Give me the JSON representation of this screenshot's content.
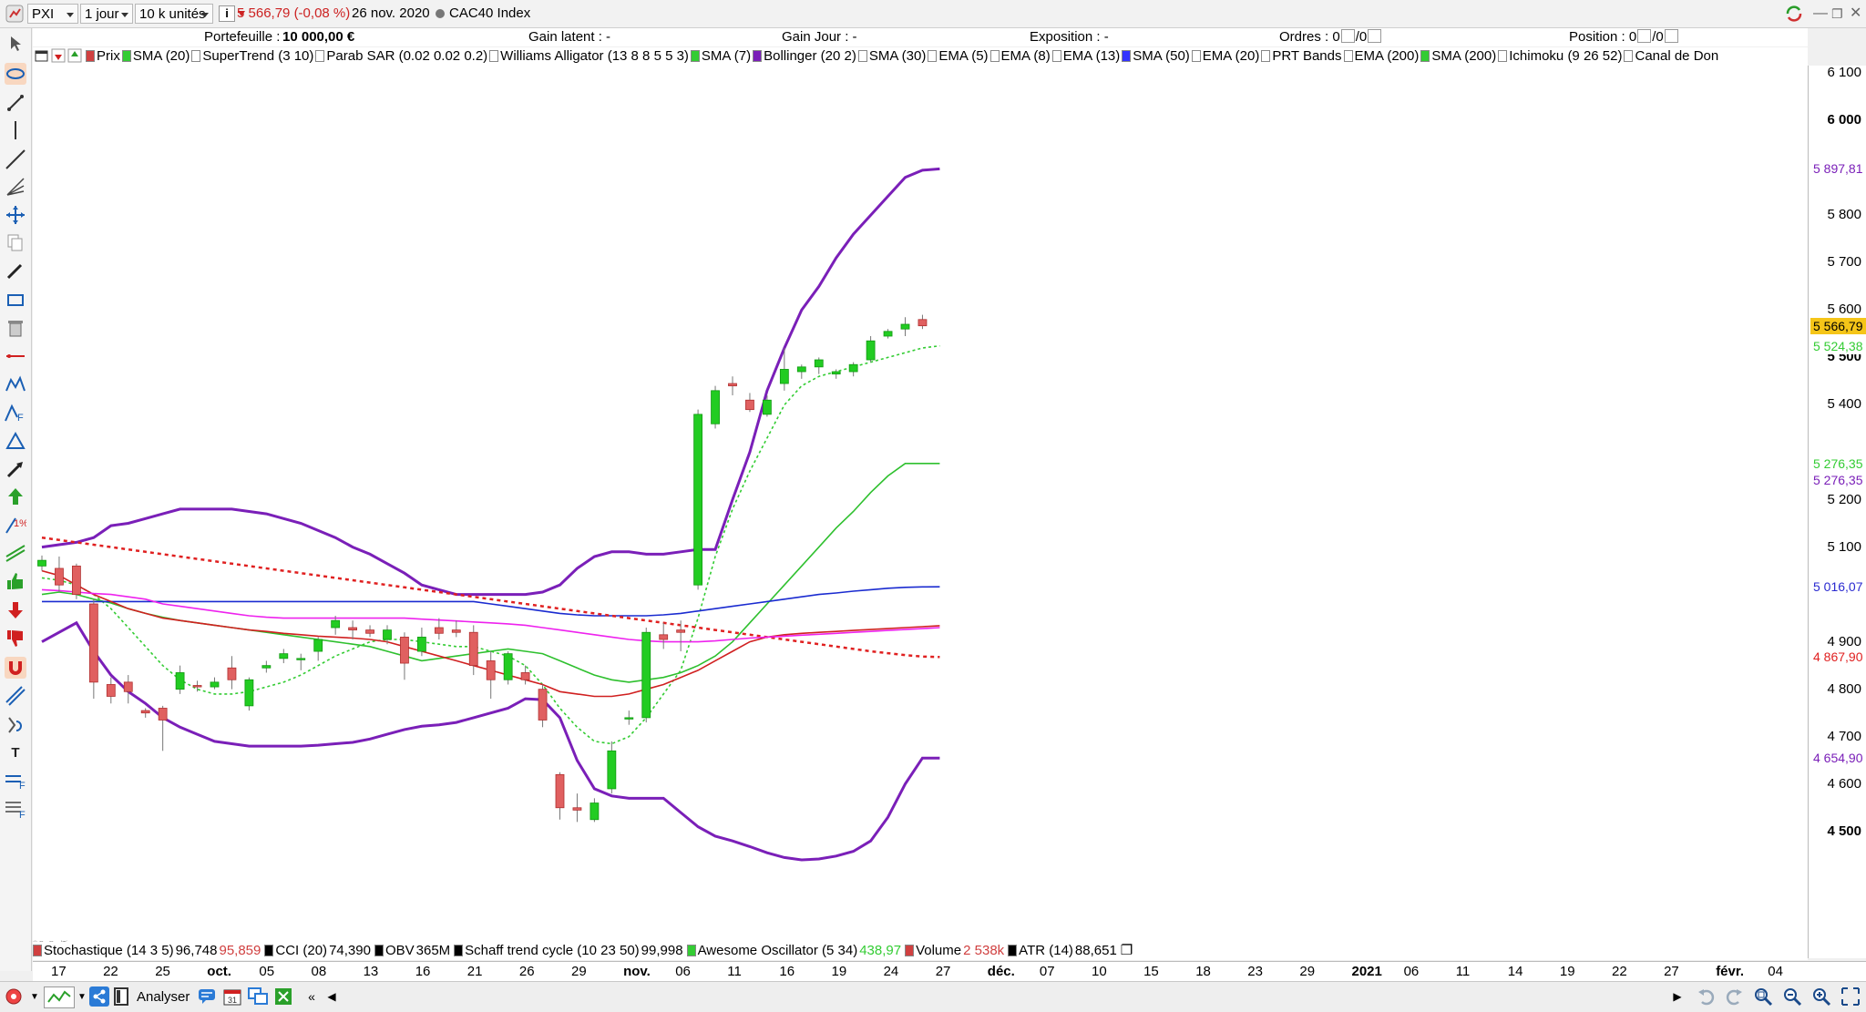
{
  "toolbar": {
    "symbol": "PXI",
    "period": "1 jour",
    "units": "10 k unités",
    "last_price": "5 566,79",
    "change": "(-0,08 %)",
    "date": "26 nov. 2020",
    "instrument": "CAC40 Index"
  },
  "stats": {
    "portfolio_label": "Portefeuille :",
    "portfolio_value": "10 000,00 €",
    "unrealized_label": "Gain latent : -",
    "day_gain_label": "Gain Jour : -",
    "exposure_label": "Exposition : -",
    "orders_label": "Ordres : 0",
    "orders_value2": "0",
    "position_label": "Position : 0",
    "position_value2": "0"
  },
  "indicators": [
    {
      "label": "Prix",
      "color": "#d04040"
    },
    {
      "label": "SMA (20)",
      "color": "#33cc33"
    },
    {
      "label": "SuperTrend (3 10)",
      "color": "#ffffff"
    },
    {
      "label": "Parab SAR (0.02 0.02 0.2)",
      "color": "#ffffff"
    },
    {
      "label": "Williams Alligator (13 8 8 5 5 3)",
      "color": "#ffffff"
    },
    {
      "label": "SMA (7)",
      "color": "#33cc33"
    },
    {
      "label": "Bollinger (20 2)",
      "color": "#7a1fb8"
    },
    {
      "label": "SMA (30)",
      "color": "#ffffff"
    },
    {
      "label": "EMA (5)",
      "color": "#ffffff"
    },
    {
      "label": "EMA (8)",
      "color": "#ffffff"
    },
    {
      "label": "EMA (13)",
      "color": "#ffffff"
    },
    {
      "label": "SMA (50)",
      "color": "#3333ff"
    },
    {
      "label": "EMA (20)",
      "color": "#ffffff"
    },
    {
      "label": "PRT Bands",
      "color": "#ffffff"
    },
    {
      "label": "EMA (200)",
      "color": "#ffffff"
    },
    {
      "label": "SMA (200)",
      "color": "#33cc33"
    },
    {
      "label": "Ichimoku (9 26 52)",
      "color": "#ffffff"
    },
    {
      "label": "Canal de Don",
      "color": "#ffffff"
    }
  ],
  "y_axis": {
    "ticks": [
      "6 100",
      "6 000",
      "5 800",
      "5 700",
      "5 600",
      "5 500",
      "5 400",
      "5 200",
      "5 100",
      "4 900",
      "4 800",
      "4 700",
      "4 600",
      "4 500"
    ],
    "bold_ticks": [
      "6 000",
      "5 500",
      "4 500"
    ],
    "tags": [
      {
        "text": "5 897,81",
        "bg": "#ffffff",
        "fg": "#7a1fb8"
      },
      {
        "text": "5 566,79",
        "bg": "#f5c518",
        "fg": "#000000"
      },
      {
        "text": "5 524,38",
        "bg": "#ffffff",
        "fg": "#33cc33"
      },
      {
        "text": "5 276,35",
        "bg": "#ffffff",
        "fg": "#33cc33"
      },
      {
        "text": "5 276,35",
        "bg": "#ffffff",
        "fg": "#7a1fb8"
      },
      {
        "text": "5 016,07",
        "bg": "#ffffff",
        "fg": "#2a2ad0"
      },
      {
        "text": "4 867,90",
        "bg": "#ffffff",
        "fg": "#e02020"
      },
      {
        "text": "4 654,90",
        "bg": "#ffffff",
        "fg": "#7a1fb8"
      }
    ]
  },
  "x_axis": {
    "labels": [
      "17",
      "22",
      "25",
      "oct.",
      "05",
      "08",
      "13",
      "16",
      "21",
      "26",
      "29",
      "nov.",
      "06",
      "11",
      "16",
      "19",
      "24",
      "27",
      "déc.",
      "07",
      "10",
      "15",
      "18",
      "23",
      "29",
      "2021",
      "06",
      "11",
      "14",
      "19",
      "22",
      "27",
      "févr.",
      "04"
    ],
    "bold_labels": [
      "oct.",
      "nov.",
      "déc.",
      "2021",
      "févr."
    ]
  },
  "bottom_legend": [
    {
      "name": "Stochastique (14 3 5)",
      "v1": "96,748",
      "v2": "95,859"
    },
    {
      "name": "CCI (20)",
      "v1": "74,390",
      "v2": ""
    },
    {
      "name": "OBV",
      "v1": "365M",
      "v2": ""
    },
    {
      "name": "Schaff trend cycle (10 23 50)",
      "v1": "99,998",
      "v2": ""
    },
    {
      "name": "Awesome Oscillator (5 34)",
      "v1": "",
      "v2": "438,97"
    },
    {
      "name": "Volume",
      "v1": "",
      "v2": "2 538k"
    },
    {
      "name": "ATR (14)",
      "v1": "88,651",
      "v2": ""
    }
  ],
  "bottom_toolbar": {
    "analyze_label": "Analyser"
  },
  "chart_data": {
    "type": "line",
    "y_range": [
      4440,
      6110
    ],
    "candles": [
      {
        "o": 5060,
        "h": 5082,
        "c": 5072,
        "l": 5050
      },
      {
        "o": 5055,
        "h": 5080,
        "c": 5020,
        "l": 5005
      },
      {
        "o": 5060,
        "h": 5065,
        "c": 5000,
        "l": 4990
      },
      {
        "o": 4980,
        "h": 4990,
        "c": 4815,
        "l": 4780
      },
      {
        "o": 4810,
        "h": 4825,
        "c": 4785,
        "l": 4770
      },
      {
        "o": 4815,
        "h": 4830,
        "c": 4795,
        "l": 4770
      },
      {
        "o": 4755,
        "h": 4760,
        "c": 4750,
        "l": 4740
      },
      {
        "o": 4760,
        "h": 4765,
        "c": 4735,
        "l": 4670
      },
      {
        "o": 4800,
        "h": 4850,
        "c": 4835,
        "l": 4790
      },
      {
        "o": 4808,
        "h": 4818,
        "c": 4805,
        "l": 4795
      },
      {
        "o": 4805,
        "h": 4825,
        "c": 4815,
        "l": 4800
      },
      {
        "o": 4845,
        "h": 4870,
        "c": 4820,
        "l": 4800
      },
      {
        "o": 4765,
        "h": 4825,
        "c": 4820,
        "l": 4755
      },
      {
        "o": 4845,
        "h": 4860,
        "c": 4850,
        "l": 4835
      },
      {
        "o": 4865,
        "h": 4885,
        "c": 4875,
        "l": 4855
      },
      {
        "o": 4865,
        "h": 4875,
        "c": 4865,
        "l": 4840
      },
      {
        "o": 4880,
        "h": 4910,
        "c": 4905,
        "l": 4860
      },
      {
        "o": 4930,
        "h": 4955,
        "c": 4945,
        "l": 4915
      },
      {
        "o": 4930,
        "h": 4945,
        "c": 4925,
        "l": 4905
      },
      {
        "o": 4925,
        "h": 4935,
        "c": 4918,
        "l": 4910
      },
      {
        "o": 4905,
        "h": 4935,
        "c": 4925,
        "l": 4895
      },
      {
        "o": 4910,
        "h": 4920,
        "c": 4855,
        "l": 4820
      },
      {
        "o": 4880,
        "h": 4930,
        "c": 4910,
        "l": 4870
      },
      {
        "o": 4930,
        "h": 4950,
        "c": 4918,
        "l": 4905
      },
      {
        "o": 4925,
        "h": 4945,
        "c": 4920,
        "l": 4910
      },
      {
        "o": 4920,
        "h": 4935,
        "c": 4850,
        "l": 4830
      },
      {
        "o": 4860,
        "h": 4880,
        "c": 4820,
        "l": 4780
      },
      {
        "o": 4820,
        "h": 4880,
        "c": 4875,
        "l": 4810
      },
      {
        "o": 4835,
        "h": 4850,
        "c": 4820,
        "l": 4810
      },
      {
        "o": 4800,
        "h": 4810,
        "c": 4735,
        "l": 4720
      },
      {
        "o": 4620,
        "h": 4625,
        "c": 4550,
        "l": 4525
      },
      {
        "o": 4550,
        "h": 4580,
        "c": 4545,
        "l": 4520
      },
      {
        "o": 4525,
        "h": 4570,
        "c": 4560,
        "l": 4520
      },
      {
        "o": 4590,
        "h": 4690,
        "c": 4670,
        "l": 4580
      },
      {
        "o": 4740,
        "h": 4755,
        "c": 4740,
        "l": 4725
      },
      {
        "o": 4740,
        "h": 4930,
        "c": 4920,
        "l": 4730
      },
      {
        "o": 4915,
        "h": 4940,
        "c": 4905,
        "l": 4885
      },
      {
        "o": 4925,
        "h": 4945,
        "c": 4920,
        "l": 4880
      },
      {
        "o": 5020,
        "h": 5390,
        "c": 5380,
        "l": 5010
      },
      {
        "o": 5360,
        "h": 5440,
        "c": 5430,
        "l": 5350
      },
      {
        "o": 5445,
        "h": 5460,
        "c": 5440,
        "l": 5420
      },
      {
        "o": 5410,
        "h": 5425,
        "c": 5390,
        "l": 5385
      },
      {
        "o": 5380,
        "h": 5420,
        "c": 5410,
        "l": 5375
      },
      {
        "o": 5445,
        "h": 5520,
        "c": 5475,
        "l": 5430
      },
      {
        "o": 5470,
        "h": 5485,
        "c": 5480,
        "l": 5455
      },
      {
        "o": 5480,
        "h": 5500,
        "c": 5495,
        "l": 5465
      },
      {
        "o": 5465,
        "h": 5475,
        "c": 5470,
        "l": 5455
      },
      {
        "o": 5470,
        "h": 5490,
        "c": 5485,
        "l": 5460
      },
      {
        "o": 5495,
        "h": 5545,
        "c": 5535,
        "l": 5490
      },
      {
        "o": 5545,
        "h": 5560,
        "c": 5555,
        "l": 5540
      },
      {
        "o": 5560,
        "h": 5585,
        "c": 5570,
        "l": 5545
      },
      {
        "o": 5580,
        "h": 5590,
        "c": 5566.79,
        "l": 5560
      }
    ],
    "series": [
      {
        "name": "Bollinger upper",
        "color": "#7a1fb8",
        "dash": "",
        "values": [
          5100,
          5105,
          5110,
          5120,
          5145,
          5150,
          5160,
          5170,
          5180,
          5180,
          5180,
          5180,
          5175,
          5170,
          5160,
          5150,
          5135,
          5120,
          5100,
          5085,
          5065,
          5045,
          5020,
          5010,
          5000,
          5000,
          5000,
          5000,
          5000,
          5005,
          5020,
          5055,
          5080,
          5090,
          5090,
          5085,
          5085,
          5090,
          5095,
          5095,
          5200,
          5300,
          5430,
          5520,
          5600,
          5650,
          5710,
          5760,
          5800,
          5840,
          5880,
          5895,
          5897.81
        ]
      },
      {
        "name": "Bollinger lower",
        "color": "#7a1fb8",
        "dash": "",
        "values": [
          4900,
          4920,
          4940,
          4880,
          4830,
          4795,
          4770,
          4740,
          4720,
          4705,
          4690,
          4685,
          4680,
          4680,
          4680,
          4680,
          4682,
          4685,
          4688,
          4695,
          4705,
          4715,
          4722,
          4725,
          4730,
          4740,
          4750,
          4760,
          4780,
          4778,
          4740,
          4650,
          4590,
          4575,
          4570,
          4570,
          4570,
          4540,
          4510,
          4490,
          4480,
          4468,
          4455,
          4445,
          4440,
          4442,
          4448,
          4458,
          4480,
          4530,
          4600,
          4654.9,
          4654.9
        ]
      },
      {
        "name": "SMA (20)",
        "color": "#2ec02e",
        "dash": "",
        "values": [
          5000,
          5005,
          5000,
          4990,
          4982,
          4970,
          4960,
          4952,
          4945,
          4940,
          4935,
          4930,
          4925,
          4920,
          4915,
          4910,
          4905,
          4900,
          4895,
          4890,
          4880,
          4870,
          4860,
          4865,
          4870,
          4875,
          4880,
          4885,
          4880,
          4875,
          4860,
          4845,
          4830,
          4820,
          4815,
          4820,
          4825,
          4835,
          4850,
          4870,
          4900,
          4940,
          4980,
          5020,
          5060,
          5100,
          5140,
          5175,
          5215,
          5250,
          5276.35,
          5276.35,
          5276.35
        ]
      },
      {
        "name": "SMA (7)",
        "color": "#33cc33",
        "dash": "3,3",
        "values": [
          5035,
          5030,
          5020,
          5000,
          4970,
          4930,
          4890,
          4850,
          4820,
          4800,
          4790,
          4790,
          4795,
          4805,
          4815,
          4830,
          4850,
          4870,
          4885,
          4900,
          4905,
          4905,
          4900,
          4895,
          4890,
          4890,
          4880,
          4870,
          4850,
          4810,
          4760,
          4720,
          4690,
          4685,
          4700,
          4740,
          4790,
          4840,
          4950,
          5080,
          5180,
          5260,
          5330,
          5400,
          5440,
          5460,
          5470,
          5480,
          5490,
          5500,
          5510,
          5520,
          5524.38
        ]
      },
      {
        "name": "SMA (50)",
        "color": "#1a2bd0",
        "dash": "",
        "values": [
          4985,
          4985,
          4985,
          4985,
          4985,
          4985,
          4985,
          4985,
          4985,
          4985,
          4985,
          4985,
          4985,
          4985,
          4985,
          4985,
          4985,
          4985,
          4985,
          4985,
          4985,
          4985,
          4985,
          4985,
          4985,
          4985,
          4980,
          4975,
          4970,
          4965,
          4960,
          4957,
          4955,
          4955,
          4955,
          4955,
          4957,
          4960,
          4965,
          4970,
          4975,
          4980,
          4985,
          4990,
          4995,
          5000,
          5003,
          5007,
          5010,
          5013,
          5015,
          5016,
          5016.07
        ]
      },
      {
        "name": "SMA (200)",
        "color": "#e02020",
        "dash": "4,4",
        "values": [
          5120,
          5115,
          5110,
          5105,
          5100,
          5095,
          5090,
          5085,
          5080,
          5075,
          5070,
          5065,
          5060,
          5055,
          5050,
          5045,
          5040,
          5035,
          5030,
          5025,
          5020,
          5015,
          5010,
          5005,
          5000,
          4995,
          4990,
          4985,
          4980,
          4975,
          4970,
          4965,
          4960,
          4955,
          4950,
          4945,
          4940,
          4935,
          4930,
          4925,
          4920,
          4915,
          4910,
          4905,
          4900,
          4895,
          4890,
          4885,
          4880,
          4876,
          4872,
          4869,
          4867.9
        ]
      },
      {
        "name": "Price EMA",
        "color": "#d02020",
        "dash": "",
        "values": [
          5050,
          5040,
          5020,
          5000,
          4985,
          4970,
          4960,
          4950,
          4945,
          4940,
          4935,
          4930,
          4925,
          4922,
          4918,
          4915,
          4912,
          4910,
          4908,
          4905,
          4900,
          4890,
          4880,
          4870,
          4860,
          4850,
          4840,
          4830,
          4820,
          4810,
          4795,
          4790,
          4785,
          4785,
          4790,
          4800,
          4810,
          4825,
          4840,
          4860,
          4880,
          4900,
          4910,
          4915,
          4918,
          4920,
          4922,
          4924,
          4926,
          4928,
          4930,
          4932,
          4934
        ]
      },
      {
        "name": "SMA (200) magenta",
        "color": "#ee22ee",
        "dash": "",
        "values": [
          5010,
          5008,
          5005,
          5002,
          5000,
          4995,
          4990,
          4980,
          4975,
          4970,
          4965,
          4960,
          4955,
          4952,
          4950,
          4950,
          4950,
          4950,
          4950,
          4950,
          4950,
          4950,
          4948,
          4946,
          4944,
          4942,
          4940,
          4938,
          4935,
          4930,
          4925,
          4920,
          4915,
          4910,
          4905,
          4902,
          4900,
          4900,
          4900,
          4902,
          4905,
          4908,
          4910,
          4912,
          4914,
          4916,
          4918,
          4920,
          4922,
          4924,
          4926,
          4928,
          4930
        ]
      }
    ]
  }
}
